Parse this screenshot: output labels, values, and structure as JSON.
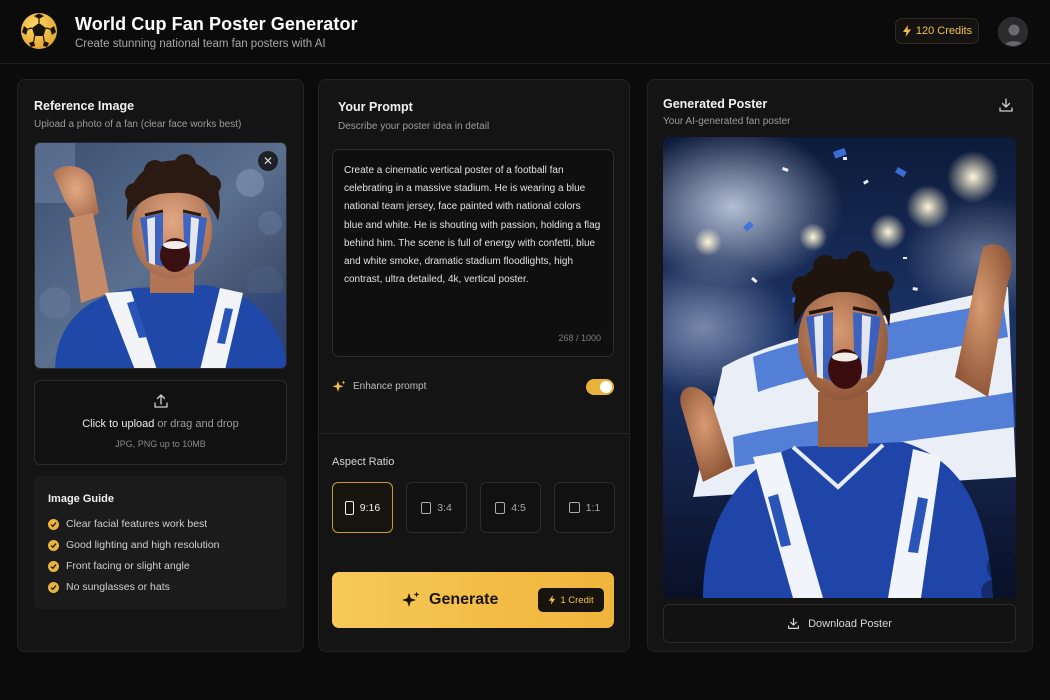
{
  "header": {
    "title": "World Cup Fan Poster Generator",
    "subtitle": "Create stunning national team fan posters with AI",
    "credits_label": "120 Credits",
    "accent_color": "#f1c04d"
  },
  "reference": {
    "title": "Reference Image",
    "subtitle": "Upload a photo of a fan (clear face works best)",
    "close_glyph": "✕",
    "upload_label_strong": "Click to upload",
    "upload_label_rest": " or drag and drop",
    "upload_hint": "JPG, PNG up to 10MB",
    "guide_title": "Image Guide",
    "guide_items": [
      "Clear facial features work best",
      "Good lighting and high resolution",
      "Front facing or slight angle",
      "No sunglasses or hats"
    ]
  },
  "prompt": {
    "title": "Your Prompt",
    "subtitle": "Describe your poster idea in detail",
    "text": "Create a cinematic vertical poster of a football fan celebrating in a massive stadium. He is wearing a blue national team jersey, face painted with national colors blue and white. He is shouting with passion, holding a flag behind him. The scene is full of energy with confetti, blue and white smoke, dramatic stadium floodlights, high contrast, ultra detailed, 4k, vertical poster.",
    "char_count": "268 / 1000",
    "enhance_label": "Enhance prompt",
    "enhance_enabled": true,
    "aspect_label": "Aspect Ratio",
    "ratios": [
      {
        "label": "9:16",
        "selected": true
      },
      {
        "label": "3:4",
        "selected": false
      },
      {
        "label": "4:5",
        "selected": false
      },
      {
        "label": "1:1",
        "selected": false
      }
    ],
    "generate_label": "Generate",
    "generate_cost": "1 Credit"
  },
  "result": {
    "title": "Generated Poster",
    "subtitle": "Your AI-generated fan poster",
    "download_label": "Download Poster"
  }
}
